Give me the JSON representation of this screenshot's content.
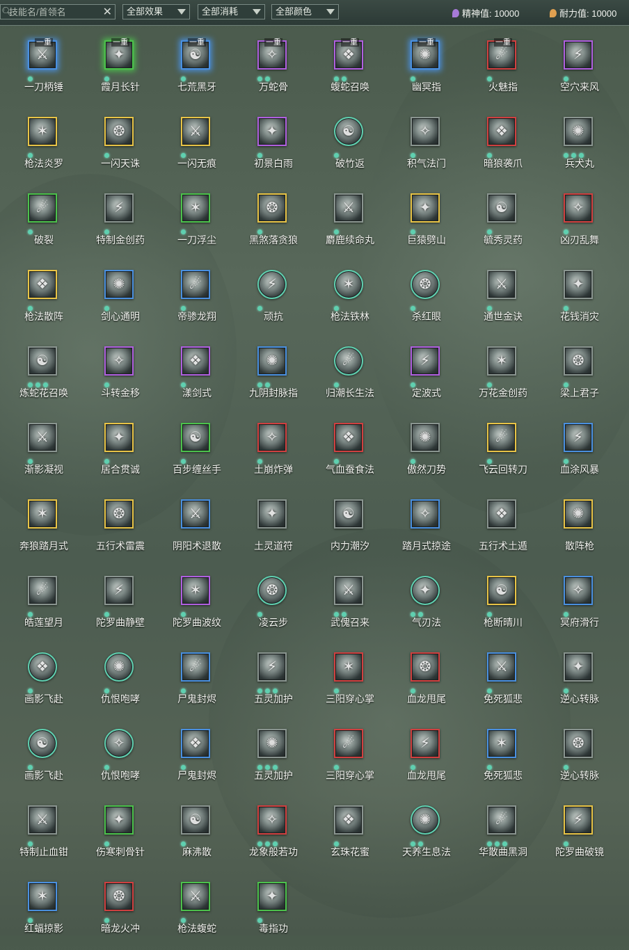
{
  "search": {
    "placeholder": "技能名/首领名",
    "clear": "✕",
    "icon": "search-icon"
  },
  "filters": [
    {
      "label": "全部效果"
    },
    {
      "label": "全部消耗"
    },
    {
      "label": "全部颜色"
    }
  ],
  "stats": {
    "spirit": {
      "label": "精神值: 10000",
      "color": "#a77ad8"
    },
    "endurance": {
      "label": "耐力值: 10000",
      "color": "#e0a050"
    }
  },
  "colors": {
    "gold": "#e8c447",
    "blue": "#4a90e0",
    "purple": "#b060e0",
    "green": "#4cc24c",
    "red": "#d04040",
    "gray": "#8a9590",
    "teal": "#5fd0b0"
  },
  "skills": [
    {
      "name": "一刀柄锤",
      "frame": "blue",
      "shape": "square",
      "dots": 1,
      "tier": "一重",
      "glow": true
    },
    {
      "name": "霞月长针",
      "frame": "green",
      "shape": "square",
      "dots": 1,
      "tier": "一重",
      "glow": true
    },
    {
      "name": "七荒黑牙",
      "frame": "blue",
      "shape": "square",
      "dots": 1,
      "tier": "一重",
      "glow": true
    },
    {
      "name": "万蛇骨",
      "frame": "purple",
      "shape": "square",
      "dots": 2,
      "tier": "一重",
      "glow": false
    },
    {
      "name": "蝮蛇召唤",
      "frame": "purple",
      "shape": "square",
      "dots": 2,
      "tier": "一重",
      "glow": false
    },
    {
      "name": "幽冥指",
      "frame": "blue",
      "shape": "square",
      "dots": 1,
      "tier": "一重",
      "glow": true
    },
    {
      "name": "火魅指",
      "frame": "red",
      "shape": "square",
      "dots": 1,
      "tier": "一重",
      "glow": false
    },
    {
      "name": "空穴来风",
      "frame": "purple",
      "shape": "square",
      "dots": 1,
      "tier": "",
      "glow": false
    },
    {
      "name": "枪法炎罗",
      "frame": "gold",
      "shape": "square",
      "dots": 1,
      "tier": "",
      "glow": false
    },
    {
      "name": "一闪天诛",
      "frame": "gold",
      "shape": "square",
      "dots": 1,
      "tier": "",
      "glow": false
    },
    {
      "name": "一闪无痕",
      "frame": "gold",
      "shape": "square",
      "dots": 1,
      "tier": "",
      "glow": false
    },
    {
      "name": "初景白雨",
      "frame": "purple",
      "shape": "square",
      "dots": 1,
      "tier": "",
      "glow": false
    },
    {
      "name": "破竹返",
      "frame": "teal",
      "shape": "round",
      "dots": 1,
      "tier": "",
      "glow": false
    },
    {
      "name": "积气法门",
      "frame": "gray",
      "shape": "square",
      "dots": 1,
      "tier": "",
      "glow": false
    },
    {
      "name": "暗狼袭爪",
      "frame": "red",
      "shape": "square",
      "dots": 1,
      "tier": "",
      "glow": false
    },
    {
      "name": "兵犬丸",
      "frame": "gray",
      "shape": "square",
      "dots": 3,
      "tier": "",
      "glow": false
    },
    {
      "name": "破裂",
      "frame": "green",
      "shape": "square",
      "dots": 1,
      "tier": "",
      "glow": false
    },
    {
      "name": "特制金创药",
      "frame": "gray",
      "shape": "square",
      "dots": 1,
      "tier": "",
      "glow": false
    },
    {
      "name": "一刀浮尘",
      "frame": "green",
      "shape": "square",
      "dots": 1,
      "tier": "",
      "glow": false
    },
    {
      "name": "黑煞落贪狼",
      "frame": "gold",
      "shape": "square",
      "dots": 1,
      "tier": "",
      "glow": false
    },
    {
      "name": "麝鹿续命丸",
      "frame": "gray",
      "shape": "square",
      "dots": 1,
      "tier": "",
      "glow": false
    },
    {
      "name": "巨猿劈山",
      "frame": "gold",
      "shape": "square",
      "dots": 1,
      "tier": "",
      "glow": false
    },
    {
      "name": "毓秀灵药",
      "frame": "gray",
      "shape": "square",
      "dots": 1,
      "tier": "",
      "glow": false
    },
    {
      "name": "凶刃乱舞",
      "frame": "red",
      "shape": "square",
      "dots": 1,
      "tier": "",
      "glow": false
    },
    {
      "name": "枪法散阵",
      "frame": "gold",
      "shape": "square",
      "dots": 1,
      "tier": "",
      "glow": false
    },
    {
      "name": "剑心通明",
      "frame": "blue",
      "shape": "square",
      "dots": 1,
      "tier": "",
      "glow": false
    },
    {
      "name": "帝骖龙翔",
      "frame": "blue",
      "shape": "square",
      "dots": 1,
      "tier": "",
      "glow": false
    },
    {
      "name": "顽抗",
      "frame": "teal",
      "shape": "round",
      "dots": 1,
      "tier": "",
      "glow": false
    },
    {
      "name": "枪法铁林",
      "frame": "teal",
      "shape": "round",
      "dots": 1,
      "tier": "",
      "glow": false
    },
    {
      "name": "杀红眼",
      "frame": "teal",
      "shape": "round",
      "dots": 1,
      "tier": "",
      "glow": false
    },
    {
      "name": "通世金诀",
      "frame": "gray",
      "shape": "square",
      "dots": 1,
      "tier": "",
      "glow": false
    },
    {
      "name": "花钱消灾",
      "frame": "gray",
      "shape": "square",
      "dots": 1,
      "tier": "",
      "glow": false
    },
    {
      "name": "炼蛇花召唤",
      "frame": "gray",
      "shape": "square",
      "dots": 3,
      "tier": "",
      "glow": false
    },
    {
      "name": "斗转金移",
      "frame": "purple",
      "shape": "square",
      "dots": 1,
      "tier": "",
      "glow": false
    },
    {
      "name": "漾剑式",
      "frame": "purple",
      "shape": "square",
      "dots": 1,
      "tier": "",
      "glow": false
    },
    {
      "name": "九阴封脉指",
      "frame": "blue",
      "shape": "square",
      "dots": 2,
      "tier": "",
      "glow": false
    },
    {
      "name": "归潮长生法",
      "frame": "teal",
      "shape": "round",
      "dots": 1,
      "tier": "",
      "glow": false
    },
    {
      "name": "定波式",
      "frame": "purple",
      "shape": "square",
      "dots": 1,
      "tier": "",
      "glow": false
    },
    {
      "name": "万花金创药",
      "frame": "gray",
      "shape": "square",
      "dots": 1,
      "tier": "",
      "glow": false
    },
    {
      "name": "梁上君子",
      "frame": "gray",
      "shape": "square",
      "dots": 1,
      "tier": "",
      "glow": false
    },
    {
      "name": "渐影凝视",
      "frame": "gray",
      "shape": "square",
      "dots": 1,
      "tier": "",
      "glow": false
    },
    {
      "name": "居合贯诚",
      "frame": "gold",
      "shape": "square",
      "dots": 1,
      "tier": "",
      "glow": false
    },
    {
      "name": "百步缠丝手",
      "frame": "green",
      "shape": "square",
      "dots": 1,
      "tier": "",
      "glow": false
    },
    {
      "name": "土崩炸弹",
      "frame": "red",
      "shape": "square",
      "dots": 1,
      "tier": "",
      "glow": false
    },
    {
      "name": "气血蚕食法",
      "frame": "red",
      "shape": "square",
      "dots": 1,
      "tier": "",
      "glow": false
    },
    {
      "name": "傲然刀势",
      "frame": "gray",
      "shape": "square",
      "dots": 1,
      "tier": "",
      "glow": false
    },
    {
      "name": "飞云回转刀",
      "frame": "gold",
      "shape": "square",
      "dots": 1,
      "tier": "",
      "glow": false
    },
    {
      "name": "血涂风暴",
      "frame": "blue",
      "shape": "square",
      "dots": 1,
      "tier": "",
      "glow": false
    },
    {
      "name": "奔狼踏月式",
      "frame": "gold",
      "shape": "square",
      "dots": 0,
      "tier": "",
      "glow": false
    },
    {
      "name": "五行术雷震",
      "frame": "gold",
      "shape": "square",
      "dots": 0,
      "tier": "",
      "glow": false
    },
    {
      "name": "阴阳术退散",
      "frame": "blue",
      "shape": "square",
      "dots": 0,
      "tier": "",
      "glow": false
    },
    {
      "name": "土灵道符",
      "frame": "gray",
      "shape": "square",
      "dots": 0,
      "tier": "",
      "glow": false
    },
    {
      "name": "内力潮汐",
      "frame": "gray",
      "shape": "square",
      "dots": 0,
      "tier": "",
      "glow": false
    },
    {
      "name": "踏月式掠途",
      "frame": "blue",
      "shape": "square",
      "dots": 0,
      "tier": "",
      "glow": false
    },
    {
      "name": "五行术土遁",
      "frame": "gray",
      "shape": "square",
      "dots": 0,
      "tier": "",
      "glow": false
    },
    {
      "name": "散阵枪",
      "frame": "gold",
      "shape": "square",
      "dots": 0,
      "tier": "",
      "glow": false
    },
    {
      "name": "皓莲望月",
      "frame": "gray",
      "shape": "square",
      "dots": 1,
      "tier": "",
      "glow": false
    },
    {
      "name": "陀罗曲静壁",
      "frame": "gray",
      "shape": "square",
      "dots": 1,
      "tier": "",
      "glow": false
    },
    {
      "name": "陀罗曲波纹",
      "frame": "purple",
      "shape": "square",
      "dots": 1,
      "tier": "",
      "glow": false
    },
    {
      "name": "凌云步",
      "frame": "teal",
      "shape": "round",
      "dots": 1,
      "tier": "",
      "glow": false
    },
    {
      "name": "武傀召来",
      "frame": "gray",
      "shape": "square",
      "dots": 2,
      "tier": "",
      "glow": false
    },
    {
      "name": "气刃法",
      "frame": "teal",
      "shape": "round",
      "dots": 2,
      "tier": "",
      "glow": false
    },
    {
      "name": "枪断晴川",
      "frame": "gold",
      "shape": "square",
      "dots": 1,
      "tier": "",
      "glow": false
    },
    {
      "name": "冥府滑行",
      "frame": "blue",
      "shape": "square",
      "dots": 1,
      "tier": "",
      "glow": false
    },
    {
      "name": "画影飞赴",
      "frame": "teal",
      "shape": "round",
      "dots": 1,
      "tier": "",
      "glow": false
    },
    {
      "name": "仇恨咆哮",
      "frame": "teal",
      "shape": "round",
      "dots": 1,
      "tier": "",
      "glow": false
    },
    {
      "name": "尸鬼封烬",
      "frame": "blue",
      "shape": "square",
      "dots": 1,
      "tier": "",
      "glow": false
    },
    {
      "name": "五灵加护",
      "frame": "gray",
      "shape": "square",
      "dots": 3,
      "tier": "",
      "glow": false
    },
    {
      "name": "三阳穿心掌",
      "frame": "red",
      "shape": "square",
      "dots": 1,
      "tier": "",
      "glow": false
    },
    {
      "name": "血龙甩尾",
      "frame": "red",
      "shape": "square",
      "dots": 1,
      "tier": "",
      "glow": false
    },
    {
      "name": "免死狐悲",
      "frame": "blue",
      "shape": "square",
      "dots": 1,
      "tier": "",
      "glow": false
    },
    {
      "name": "逆心转脉",
      "frame": "gray",
      "shape": "square",
      "dots": 1,
      "tier": "",
      "glow": false
    },
    {
      "name": "画影飞赴",
      "frame": "teal",
      "shape": "round",
      "dots": 1,
      "tier": "",
      "glow": false
    },
    {
      "name": "仇恨咆哮",
      "frame": "teal",
      "shape": "round",
      "dots": 1,
      "tier": "",
      "glow": false
    },
    {
      "name": "尸鬼封烬",
      "frame": "blue",
      "shape": "square",
      "dots": 1,
      "tier": "",
      "glow": false
    },
    {
      "name": "五灵加护",
      "frame": "gray",
      "shape": "square",
      "dots": 3,
      "tier": "",
      "glow": false
    },
    {
      "name": "三阳穿心掌",
      "frame": "red",
      "shape": "square",
      "dots": 1,
      "tier": "",
      "glow": false
    },
    {
      "name": "血龙甩尾",
      "frame": "red",
      "shape": "square",
      "dots": 1,
      "tier": "",
      "glow": false
    },
    {
      "name": "免死狐悲",
      "frame": "blue",
      "shape": "square",
      "dots": 1,
      "tier": "",
      "glow": false
    },
    {
      "name": "逆心转脉",
      "frame": "gray",
      "shape": "square",
      "dots": 1,
      "tier": "",
      "glow": false
    },
    {
      "name": "特制止血钳",
      "frame": "gray",
      "shape": "square",
      "dots": 1,
      "tier": "",
      "glow": false
    },
    {
      "name": "伤寒刺骨针",
      "frame": "green",
      "shape": "square",
      "dots": 1,
      "tier": "",
      "glow": false
    },
    {
      "name": "麻沸散",
      "frame": "gray",
      "shape": "square",
      "dots": 1,
      "tier": "",
      "glow": false
    },
    {
      "name": "龙象般若功",
      "frame": "red",
      "shape": "square",
      "dots": 3,
      "tier": "",
      "glow": false
    },
    {
      "name": "玄珠花蜜",
      "frame": "gray",
      "shape": "square",
      "dots": 1,
      "tier": "",
      "glow": false
    },
    {
      "name": "天养生息法",
      "frame": "teal",
      "shape": "round",
      "dots": 2,
      "tier": "",
      "glow": false
    },
    {
      "name": "华散曲黑洞",
      "frame": "gray",
      "shape": "square",
      "dots": 3,
      "tier": "",
      "glow": false
    },
    {
      "name": "陀罗曲破镜",
      "frame": "gold",
      "shape": "square",
      "dots": 1,
      "tier": "",
      "glow": false
    },
    {
      "name": "红蝠掠影",
      "frame": "blue",
      "shape": "square",
      "dots": 1,
      "tier": "",
      "glow": false
    },
    {
      "name": "暗龙火冲",
      "frame": "red",
      "shape": "square",
      "dots": 1,
      "tier": "",
      "glow": false
    },
    {
      "name": "枪法蝮蛇",
      "frame": "green",
      "shape": "square",
      "dots": 1,
      "tier": "",
      "glow": false
    },
    {
      "name": "毒指功",
      "frame": "green",
      "shape": "square",
      "dots": 1,
      "tier": "",
      "glow": false
    }
  ]
}
